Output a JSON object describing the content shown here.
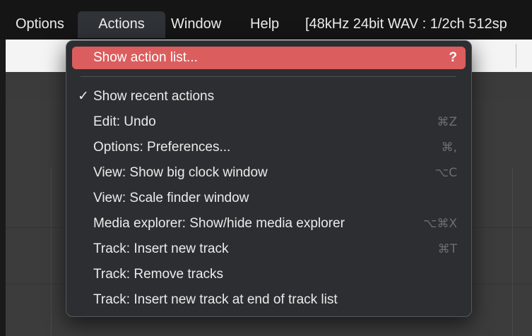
{
  "menubar": {
    "items": [
      {
        "label": "Options"
      },
      {
        "label": "Actions"
      },
      {
        "label": "Window"
      },
      {
        "label": "Help"
      }
    ],
    "status": "[48kHz 24bit WAV : 1/2ch 512sp"
  },
  "dropdown": {
    "items": [
      {
        "label": "Show action list...",
        "shortcut": "?",
        "highlighted": true
      },
      {
        "label": "Show recent actions",
        "check": "✓",
        "checked": true
      },
      {
        "label": "Edit: Undo",
        "shortcut": "⌘Z"
      },
      {
        "label": "Options: Preferences...",
        "shortcut": "⌘,"
      },
      {
        "label": "View: Show big clock window",
        "shortcut": "⌥C"
      },
      {
        "label": "View: Scale finder window"
      },
      {
        "label": "Media explorer: Show/hide media explorer",
        "shortcut": "⌥⌘X"
      },
      {
        "label": "Track: Insert new track",
        "shortcut": "⌘T"
      },
      {
        "label": "Track: Remove tracks"
      },
      {
        "label": "Track: Insert new track at end of track list"
      }
    ]
  },
  "colors": {
    "highlight": "#dc5d5d",
    "menu_background": "#2c2e31",
    "menubar_background": "#151515"
  }
}
